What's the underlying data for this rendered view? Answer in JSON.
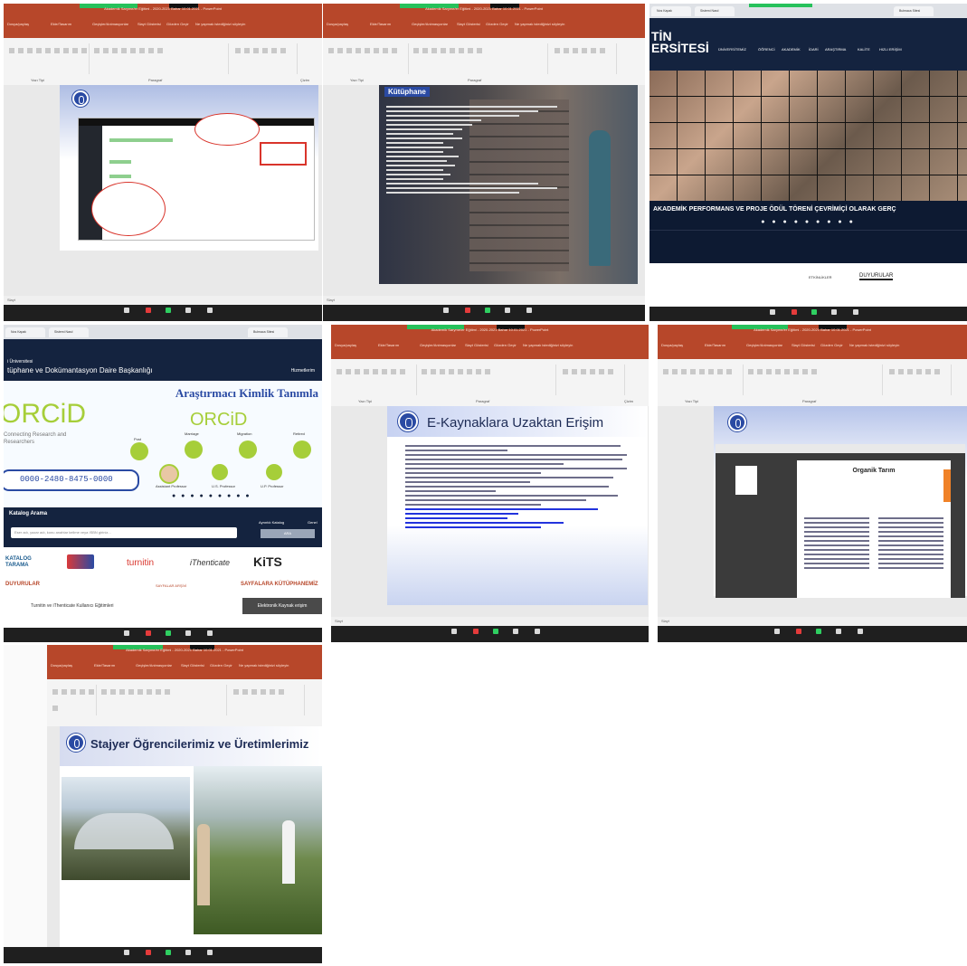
{
  "powerpoint": {
    "window_title": "Akademik Saryme/er Eğitimi - 2020-2021 Bahar 10.01.2021 - PowerPoint",
    "menu": [
      "Dosya/paylaş",
      "Ekle/Tasarım",
      "Geçişler/Animasyonlar",
      "Slayt Gösterisi",
      "Gözden Geçir",
      "Görünüm",
      "Ne yapmak istediğinizi söyleyin"
    ],
    "ribbon_groups": [
      "Yazı Tipi",
      "Paragraf",
      "Çizim"
    ],
    "status": "Slayt"
  },
  "zoom_bar": {
    "buttons": [
      "Sessize Al",
      "Video",
      "Katılımcılar",
      "Ekran Paylaş",
      "Sohbet"
    ]
  },
  "tile2": {
    "slide_title": "Kütüphane"
  },
  "tile3": {
    "tabs": [
      "Nos Kapalı",
      "Sistemi Nasıl",
      "Bulmaca Sitesi"
    ],
    "brand": "TİN\nERSİTESİ",
    "nav": [
      "ÜNİVERSİTEMİZ",
      "ÖĞRENCİ",
      "AKADEMİK",
      "İDARİ",
      "ARAŞTIRMA",
      "KALİTE",
      "HIZLI ERİŞİM"
    ],
    "banner": "AKADEMİK PERFORMANS VE PROJE ÖDÜL TÖRENİ ÇEVRİMİÇİ OLARAK GERÇ",
    "footer_tabs": [
      "ETKİNLİKLER",
      "DUYURULAR"
    ]
  },
  "tile4": {
    "header_small": "i Üniversitesi",
    "header": "tüphane ve Dokümantasyon Daire Başkanlığı",
    "header_right": "Hizmetlerim",
    "headline": "Araştırmacı Kimlik Tanımla",
    "orcid": "ORCiD",
    "orcid_tag": "Connecting Research and Researchers",
    "orcid_small": "ORCiD",
    "stages": [
      "Post",
      "Marriage",
      "Migration",
      "Retired"
    ],
    "roles": [
      "Assistant Professor",
      "U.S. Professor",
      "U.P. Professor"
    ],
    "id_number": "0000-2480-8475-0000",
    "search_title": "Katalog Arama",
    "search_ph": "Eser adı, yazar adı, konu anahtar kelime veya ISBN giriniz...",
    "search_btn": "ARA",
    "options": [
      "Ayrıntılı Katalog",
      "Genel"
    ],
    "logos": [
      "KATALOG TARAMA",
      "turnitin",
      "iThenticate",
      "KiTS"
    ],
    "news_left": "DUYURULAR",
    "news_mid": "SAYFALAR ARŞİVİ",
    "news_right": "SAYFALARA KÜTÜPHANEMİZ",
    "news_item": "Turnitin ve iThenticate Kullanıcı Eğitimleri",
    "news_btn": "Elektronik Kaynak erişim"
  },
  "tile5": {
    "slide_title": "E-Kaynaklara Uzaktan Erişim"
  },
  "tile6": {
    "doc_title": "Organik Tarım"
  },
  "tile7": {
    "slide_title": "Stajyer Öğrencilerimiz ve Üretimlerimiz"
  },
  "colors": {
    "ppt_red": "#b7472a",
    "zoom_green": "#2fcf61",
    "slide_blue": "#2a4aa3"
  }
}
